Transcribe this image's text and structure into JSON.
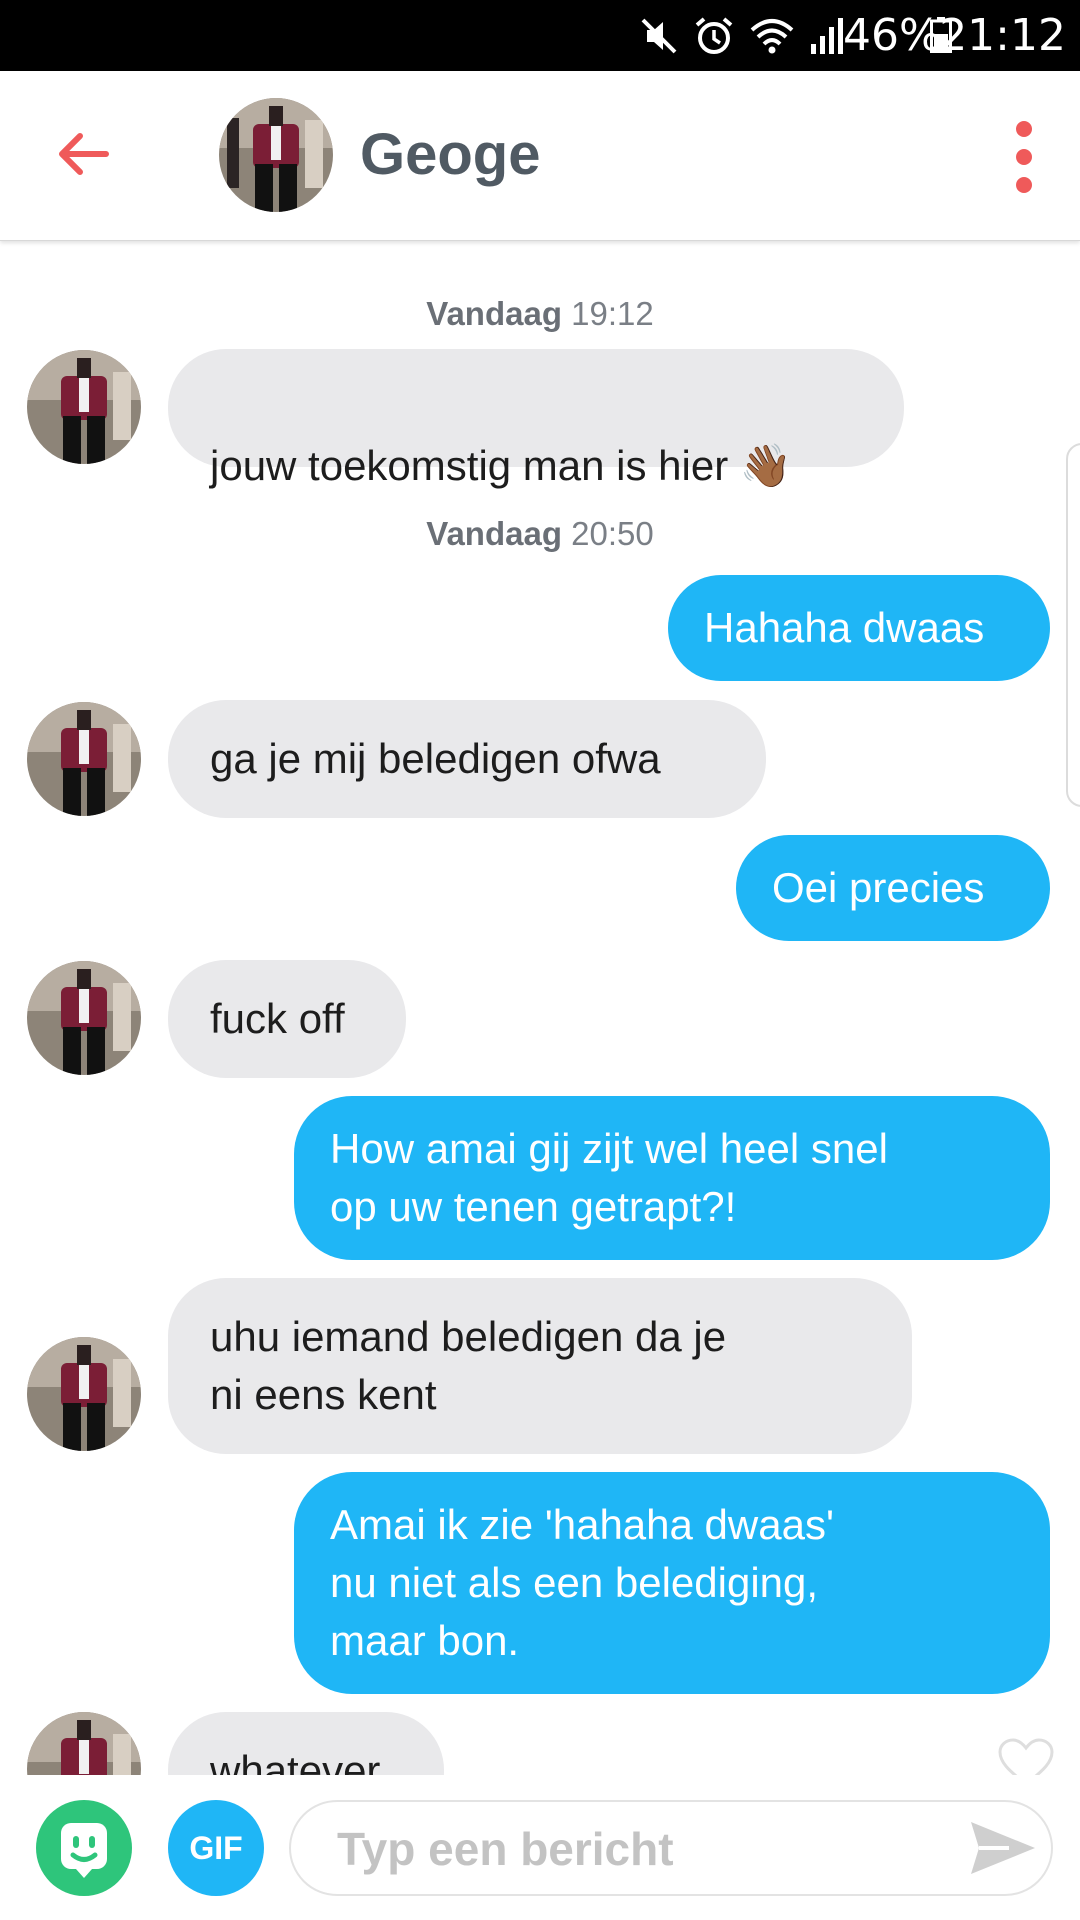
{
  "status_bar": {
    "battery_percent": "46%",
    "time": "21:12",
    "icons": [
      "mute-icon",
      "alarm-icon",
      "wifi-icon",
      "signal-icon",
      "battery-icon"
    ]
  },
  "header": {
    "contact_name": "Geoge",
    "icons": [
      "back-arrow-icon",
      "more-vertical-icon"
    ],
    "accent_color": "#ef5a5a"
  },
  "messages": [
    {
      "type": "timestamp",
      "day": "Vandaag",
      "time": "19:12"
    },
    {
      "type": "in",
      "text": "jouw toekomstig man is hier",
      "emoji": "👋🏾"
    },
    {
      "type": "timestamp",
      "day": "Vandaag",
      "time": "20:50"
    },
    {
      "type": "out",
      "text": "Hahaha dwaas"
    },
    {
      "type": "in",
      "text": "ga je mij beledigen ofwa"
    },
    {
      "type": "out",
      "text": "Oei precies"
    },
    {
      "type": "in",
      "text": "fuck off"
    },
    {
      "type": "out",
      "text": "How amai gij zijt wel heel snel\nop uw tenen getrapt?!"
    },
    {
      "type": "in",
      "text": "uhu iemand beledigen da je\nni eens kent"
    },
    {
      "type": "out",
      "text": "Amai ik zie 'hahaha dwaas'\nnu niet als een belediging,\nmaar bon."
    },
    {
      "type": "in",
      "text": "whatever"
    }
  ],
  "composer": {
    "gif_label": "GIF",
    "placeholder": "Typ een bericht",
    "icons": [
      "sticker-icon",
      "send-icon"
    ]
  },
  "colors": {
    "outgoing_bubble": "#1fb6f6",
    "incoming_bubble": "#e9e9eb",
    "sticker_button": "#2ec57b"
  }
}
